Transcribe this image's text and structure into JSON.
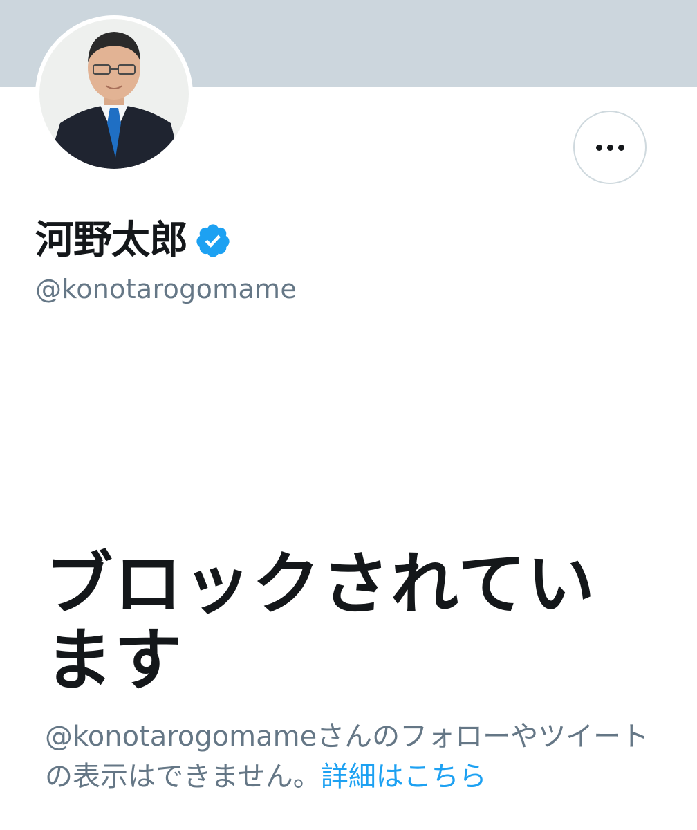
{
  "profile": {
    "display_name": "河野太郎",
    "handle": "@konotarogomame",
    "verified_icon": "verified-badge-icon",
    "more_icon": "more-horizontal-icon"
  },
  "blocked": {
    "title": "ブロックされています",
    "desc_prefix": "@konotarogomameさんのフォローやツイートの表示はできません。",
    "learn_more": "詳細はこちら"
  },
  "colors": {
    "banner": "#ccd6dd",
    "primary_text": "#14171a",
    "secondary_text": "#657786",
    "accent": "#1da1f2"
  }
}
